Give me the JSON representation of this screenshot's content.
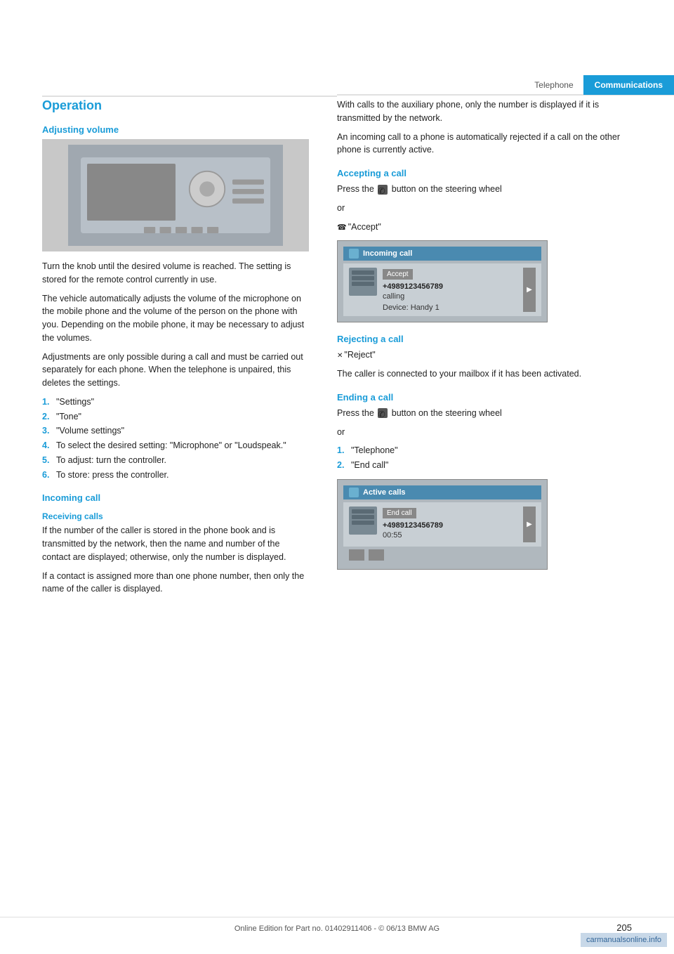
{
  "header": {
    "tab_telephone": "Telephone",
    "tab_communications": "Communications"
  },
  "left_col": {
    "section_title": "Operation",
    "adjusting_volume_title": "Adjusting volume",
    "adjusting_volume_paras": [
      "Turn the knob until the desired volume is reached. The setting is stored for the remote control currently in use.",
      "The vehicle automatically adjusts the volume of the microphone on the mobile phone and the volume of the person on the phone with you. Depending on the mobile phone, it may be necessary to adjust the volumes.",
      "Adjustments are only possible during a call and must be carried out separately for each phone. When the telephone is unpaired, this deletes the settings."
    ],
    "settings_list": [
      {
        "num": "1.",
        "text": "\"Settings\""
      },
      {
        "num": "2.",
        "text": "\"Tone\""
      },
      {
        "num": "3.",
        "text": "\"Volume settings\""
      },
      {
        "num": "4.",
        "text": "To select the desired setting: \"Microphone\" or \"Loudspeak.\""
      },
      {
        "num": "5.",
        "text": "To adjust: turn the controller."
      },
      {
        "num": "6.",
        "text": "To store: press the controller."
      }
    ],
    "incoming_call_title": "Incoming call",
    "receiving_calls_title": "Receiving calls",
    "receiving_para1": "If the number of the caller is stored in the phone book and is transmitted by the network, then the name and number of the contact are displayed; otherwise, only the number is displayed.",
    "receiving_para2": "If a contact is assigned more than one phone number, then only the name of the caller is displayed."
  },
  "right_col": {
    "para1": "With calls to the auxiliary phone, only the number is displayed if it is transmitted by the network.",
    "para2": "An incoming call to a phone is automatically rejected if a call on the other phone is currently active.",
    "accepting_call_title": "Accepting a call",
    "accepting_para1": "Press the",
    "accepting_para1b": "button on the steering wheel",
    "accepting_or": "or",
    "accepting_voice": "\"Accept\"",
    "incoming_call_screen": {
      "header": "Incoming call",
      "accept_btn": "Accept",
      "phone_number": "+4989123456789",
      "calling": "calling",
      "device": "Device: Handy 1"
    },
    "rejecting_call_title": "Rejecting a call",
    "rejecting_voice": "\"Reject\"",
    "rejecting_para": "The caller is connected to your mailbox if it has been activated.",
    "ending_call_title": "Ending a call",
    "ending_para1": "Press the",
    "ending_para1b": "button on the steering wheel",
    "ending_or": "or",
    "ending_list": [
      {
        "num": "1.",
        "text": "\"Telephone\""
      },
      {
        "num": "2.",
        "text": "\"End call\""
      }
    ],
    "active_calls_screen": {
      "header": "Active calls",
      "end_call_btn": "End call",
      "phone_number": "+4989123456789",
      "duration": "00:55"
    }
  },
  "footer": {
    "text": "Online Edition for Part no. 01402911406 - © 06/13 BMW AG"
  },
  "page_number": "205"
}
